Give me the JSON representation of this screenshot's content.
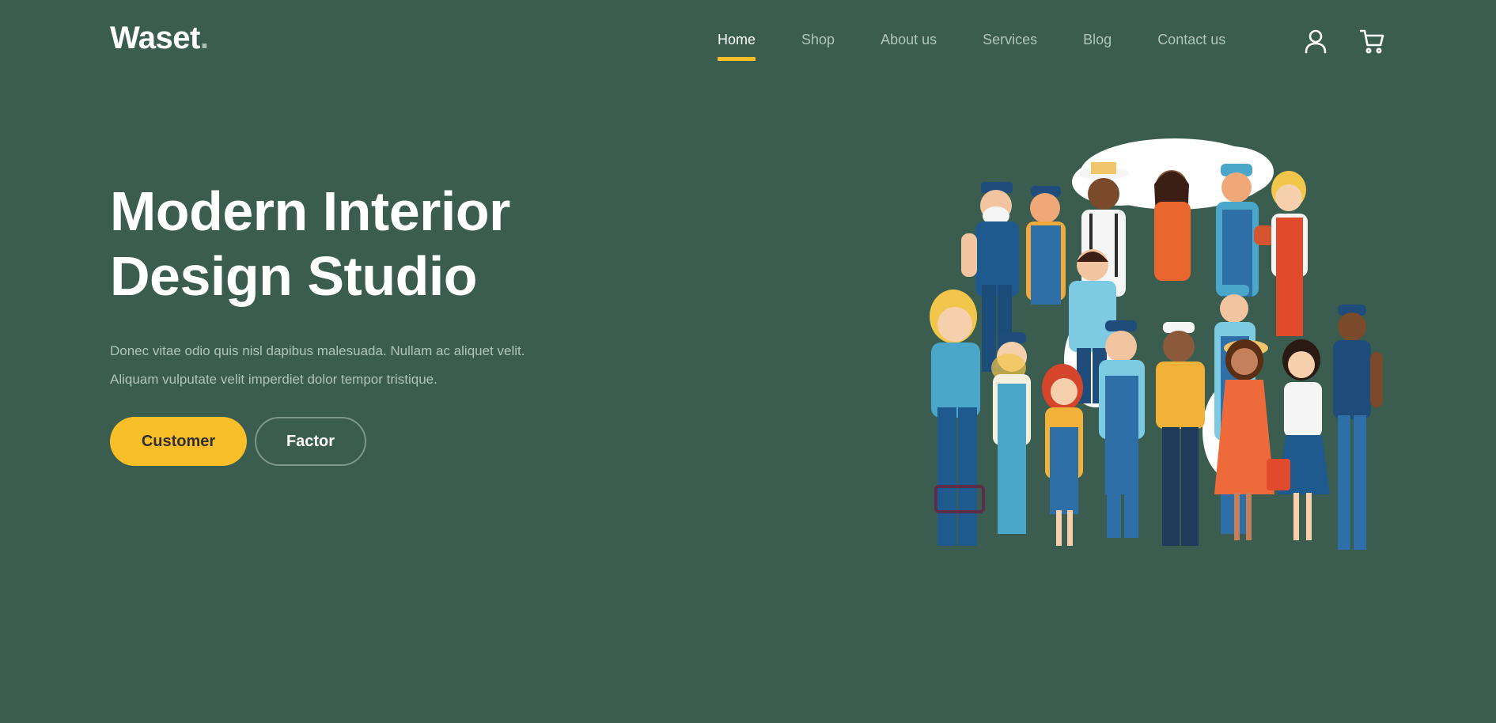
{
  "brand": {
    "name": "Waset",
    "dot": "."
  },
  "nav": {
    "items": [
      {
        "label": "Home",
        "active": true
      },
      {
        "label": "Shop",
        "active": false
      },
      {
        "label": "About us",
        "active": false
      },
      {
        "label": "Services",
        "active": false
      },
      {
        "label": "Blog",
        "active": false
      },
      {
        "label": "Contact us",
        "active": false
      }
    ],
    "icons": [
      "user-icon",
      "cart-icon"
    ]
  },
  "hero": {
    "title_line1": "Modern Interior",
    "title_line2": "Design Studio",
    "description": "Donec vitae odio quis nisl dapibus malesuada. Nullam ac aliquet velit. Aliquam vulputate velit imperdiet dolor tempor tristique.",
    "primary_button": "Customer",
    "secondary_button": "Factor"
  },
  "colors": {
    "background": "#3b5d50",
    "accent": "#f9bf29",
    "muted_text": "#b0c4bb",
    "white": "#ffffff"
  }
}
